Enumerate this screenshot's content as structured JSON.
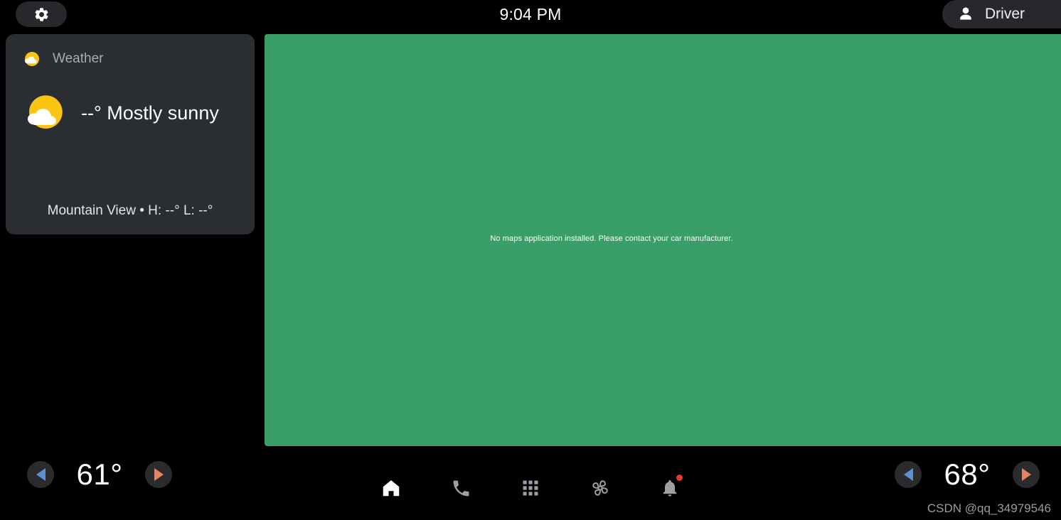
{
  "status_bar": {
    "settings_icon": "gear-icon",
    "clock": "9:04 PM",
    "profile_icon": "person-icon",
    "profile_label": "Driver"
  },
  "weather_card": {
    "app_icon": "sun-behind-cloud-icon",
    "app_label": "Weather",
    "condition_icon": "sun-behind-cloud-icon",
    "condition": "--° Mostly sunny",
    "location_line": "Mountain View • H: --° L: --°"
  },
  "map_panel": {
    "message": "No maps application installed. Please contact your car manufacturer.",
    "background_color": "#3a9e69"
  },
  "climate": {
    "left": {
      "decrease_icon": "triangle-left-icon",
      "value": "61°",
      "increase_icon": "triangle-right-icon"
    },
    "right": {
      "decrease_icon": "triangle-left-icon",
      "value": "68°",
      "increase_icon": "triangle-right-icon"
    },
    "cool_color": "#5b8fd6",
    "warm_color": "#e8835f"
  },
  "nav_bar": {
    "items": [
      {
        "name": "home",
        "icon": "home-icon",
        "active": true
      },
      {
        "name": "dialer",
        "icon": "phone-icon",
        "active": false
      },
      {
        "name": "app-grid",
        "icon": "grid-icon",
        "active": false
      },
      {
        "name": "climate",
        "icon": "fan-icon",
        "active": false
      },
      {
        "name": "notifications",
        "icon": "bell-icon",
        "active": false,
        "badge": true
      }
    ]
  },
  "watermark": "CSDN @qq_34979546"
}
